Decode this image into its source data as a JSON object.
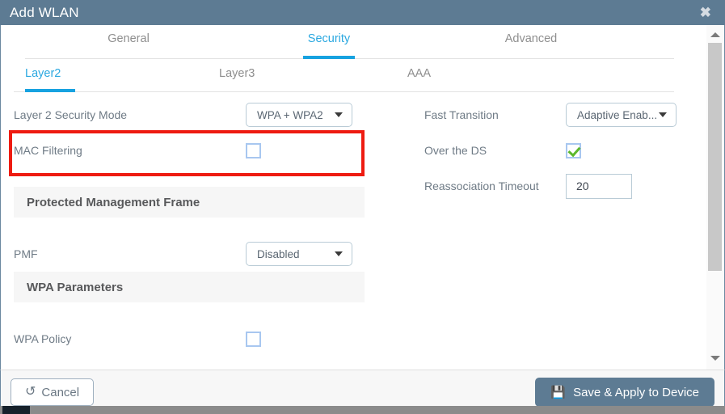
{
  "window": {
    "title": "Add WLAN",
    "close_label": "✖"
  },
  "tabs_primary": [
    {
      "label": "General",
      "active": false
    },
    {
      "label": "Security",
      "active": true
    },
    {
      "label": "Advanced",
      "active": false
    }
  ],
  "tabs_secondary": [
    {
      "label": "Layer2",
      "active": true
    },
    {
      "label": "Layer3",
      "active": false
    },
    {
      "label": "AAA",
      "active": false
    }
  ],
  "left_column": {
    "layer2_security_mode": {
      "label": "Layer 2 Security Mode",
      "value": "WPA + WPA2"
    },
    "mac_filtering": {
      "label": "MAC Filtering",
      "checked": false
    },
    "section_pmf": "Protected Management Frame",
    "pmf": {
      "label": "PMF",
      "value": "Disabled"
    },
    "section_wpa": "WPA Parameters",
    "wpa_policy": {
      "label": "WPA Policy",
      "checked": false
    }
  },
  "right_column": {
    "fast_transition": {
      "label": "Fast Transition",
      "value": "Adaptive Enab..."
    },
    "over_the_ds": {
      "label": "Over the DS",
      "checked": true
    },
    "reassociation_timeout": {
      "label": "Reassociation Timeout",
      "value": "20"
    }
  },
  "footer": {
    "cancel_label": "Cancel",
    "cancel_icon": "↺",
    "save_label": "Save & Apply to Device",
    "save_icon": "💾"
  },
  "colors": {
    "titlebar": "#5d7b93",
    "accent_tab": "#17a2e0",
    "highlight": "#ee1b11",
    "check_green": "#5cb82c",
    "checkbox_border": "#a8c7f0"
  }
}
